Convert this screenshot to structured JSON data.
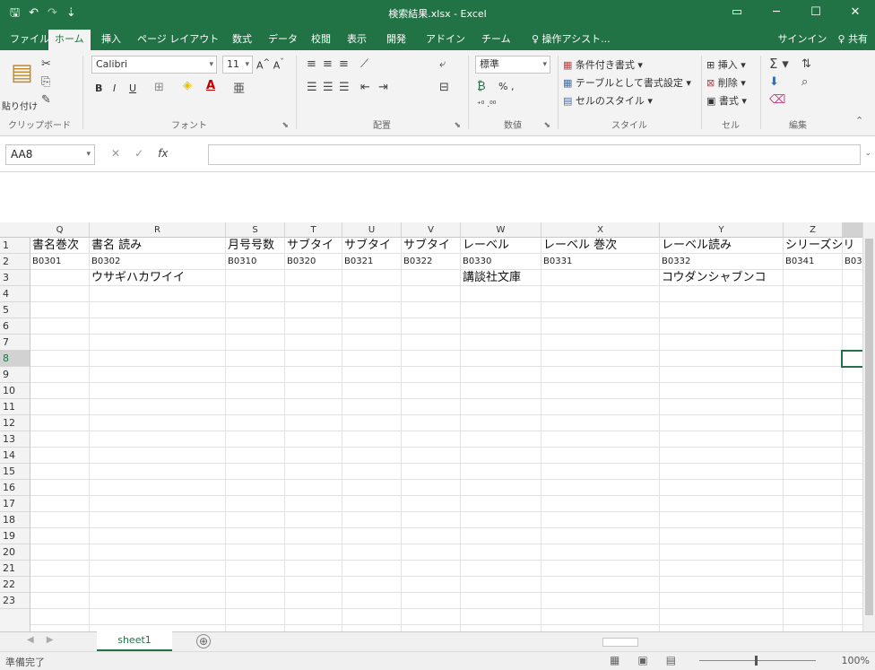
{
  "window": {
    "title": "検索結果.xlsx - Excel",
    "controls": [
      "▭",
      "─",
      "☐",
      "✕"
    ]
  },
  "qat": {
    "save_icon": "save-icon",
    "undo": "↶",
    "redo": "↷",
    "customize": "⇣"
  },
  "tabs": [
    {
      "label": "ファイル"
    },
    {
      "label": "ホーム"
    },
    {
      "label": "挿入"
    },
    {
      "label": "ページ レイアウト"
    },
    {
      "label": "数式"
    },
    {
      "label": "データ"
    },
    {
      "label": "校閲"
    },
    {
      "label": "表示"
    },
    {
      "label": "開発"
    },
    {
      "label": "アドイン"
    },
    {
      "label": "チーム"
    },
    {
      "label": "♀ 操作アシスト..."
    }
  ],
  "account": {
    "signin": "サインイン",
    "share": "♀ 共有"
  },
  "ribbon": {
    "clipboard": {
      "paste": "貼り付け",
      "label": "クリップボード"
    },
    "font": {
      "name": "Calibri",
      "size": "11",
      "label": "フォント",
      "bold": "B",
      "italic": "I",
      "underline": "U"
    },
    "alignment": {
      "label": "配置"
    },
    "number": {
      "format": "標準",
      "percent": "% ,",
      "label": "数値"
    },
    "styles": {
      "conditional": "条件付き書式 ▾",
      "table": "テーブルとして書式設定 ▾",
      "cell": "セルのスタイル ▾",
      "label": "スタイル"
    },
    "cells": {
      "insert": "挿入 ▾",
      "delete": "削除 ▾",
      "format": "書式 ▾",
      "label": "セル"
    },
    "editing": {
      "label": "編集"
    }
  },
  "formula": {
    "namebox": "AA8",
    "cancel": "✕",
    "enter": "✓",
    "fx": "fx",
    "value": ""
  },
  "columns": [
    "Q",
    "R",
    "S",
    "T",
    "U",
    "V",
    "W",
    "X",
    "Y",
    "Z"
  ],
  "rows": [
    "1",
    "2",
    "3",
    "4",
    "5",
    "6",
    "7",
    "8",
    "9",
    "10",
    "11",
    "12",
    "13",
    "14",
    "15",
    "16",
    "17",
    "18",
    "19",
    "20",
    "21",
    "22",
    "23"
  ],
  "cells": {
    "row1": [
      "書名巻次",
      "書名 読み",
      "月号号数",
      "サブタイ",
      "サブタイ",
      "サブタイ",
      "レーベル",
      "レーベル 巻次",
      "レーベル読み",
      "シリーズシリ"
    ],
    "row2": [
      "B0301",
      "B0302",
      "B0310",
      "B0320",
      "B0321",
      "B0322",
      "B0330",
      "B0331",
      "B0332",
      "B0341",
      "B03"
    ],
    "row3": [
      "",
      "ウサギハカワイイ",
      "",
      "",
      "",
      "",
      "講談社文庫",
      "",
      "コウダンシャブンコ",
      ""
    ]
  },
  "sheet": {
    "name": "sheet1",
    "add": "⊕"
  },
  "status": {
    "ready": "準備完了",
    "zoom": "100%"
  }
}
